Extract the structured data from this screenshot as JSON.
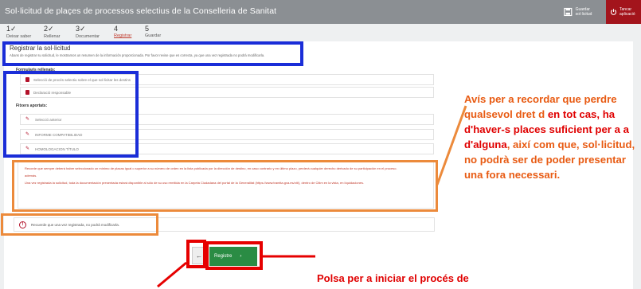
{
  "header": {
    "title": "Sol·licitud de plaçes de processos selectius de la Conselleria de Sanitat",
    "save_label": "Guardar sol·licitud",
    "close_label": "Tancar aplicació"
  },
  "steps": [
    {
      "num": "1✓",
      "label": "Deixar saber"
    },
    {
      "num": "2✓",
      "label": "Rellenar"
    },
    {
      "num": "3✓",
      "label": "Documentar"
    },
    {
      "num": "4",
      "label": "Registrar"
    },
    {
      "num": "5",
      "label": "Guardar"
    }
  ],
  "main": {
    "title": "Registrar la sol·licitud",
    "subtitle": "Abans de registrar su solicitud, le mostramos un resumen de la información proporcionada. Por favor revise que es correcta, ya que una vez registrada no podrá modificarla.",
    "forms_heading": "Formularis rellenats:",
    "forms": [
      "Selecció de procés selectiu sobre el que sol·licitar les destins",
      "Declaració responsable"
    ],
    "attachments_heading": "Fitxers aportats:",
    "attachments": [
      "Selecció anterior",
      "INFORME COMPATIBILIDAD",
      "HOMOLOGACION TÍTULO"
    ],
    "notice_p1": "Recorde que sempre deberá haber seleccionado un mínimo de plazas igual o superior a su número de orden en la lista publicada por la dirección de destino, en caso contrario y en último plazo, perderá cualquier derecho derivado de su participación en el proceso.",
    "notice_p2": "además.",
    "notice_p3": "Una vez registrada la solicitud, toda la documentación presentada estará disponible al sólo de su uso remitida en la Carpeta Ciudadana del portal de la Generalitat (https://www.tramita.gva.es/ctt/), dentro de Citim en la vista, en líquidaciones.",
    "note": "Recuerde que una vez registrada, no podrá modificarla.",
    "back_label": "←",
    "register_label": "Registre",
    "register_arrow": "›"
  },
  "callouts": {
    "orange_parts": [
      {
        "text": "Avís per a recordar que",
        "color": "#e85b13"
      },
      {
        "text": " ",
        "color": "#e85b13"
      },
      {
        "text": "perdre qualsevol dret d",
        "color": "#e85b13"
      },
      {
        "text": " ",
        "color": "#e85b13"
      },
      {
        "text": "en tot cas, ha d'haver-s",
        "color": "#e00000"
      },
      {
        "text": " ",
        "color": "#e00000"
      },
      {
        "text": "places suficient per a a",
        "color": "#e00000"
      },
      {
        "text": " ",
        "color": "#e00000"
      },
      {
        "text": "d'alguna",
        "color": "#e00000"
      },
      {
        "text": ", així com que,",
        "color": "#e85b13"
      },
      {
        "text": " ",
        "color": "#e85b13"
      },
      {
        "text": "sol·licitud, no podrà ser",
        "color": "#e85b13"
      },
      {
        "text": " ",
        "color": "#e85b13"
      },
      {
        "text": "de poder presentar una",
        "color": "#e85b13"
      },
      {
        "text": " ",
        "color": "#e85b13"
      },
      {
        "text": "fora necessari.",
        "color": "#e85b13"
      }
    ],
    "red": "Polsa per a iniciar el procés de"
  },
  "colors": {
    "header_bg": "#8b8f93",
    "close_bg": "#a3141c",
    "register_bg": "#2a8c44",
    "annotation_blue": "#1a2dd8",
    "annotation_orange": "#ec8a3b",
    "annotation_red": "#e60000"
  }
}
